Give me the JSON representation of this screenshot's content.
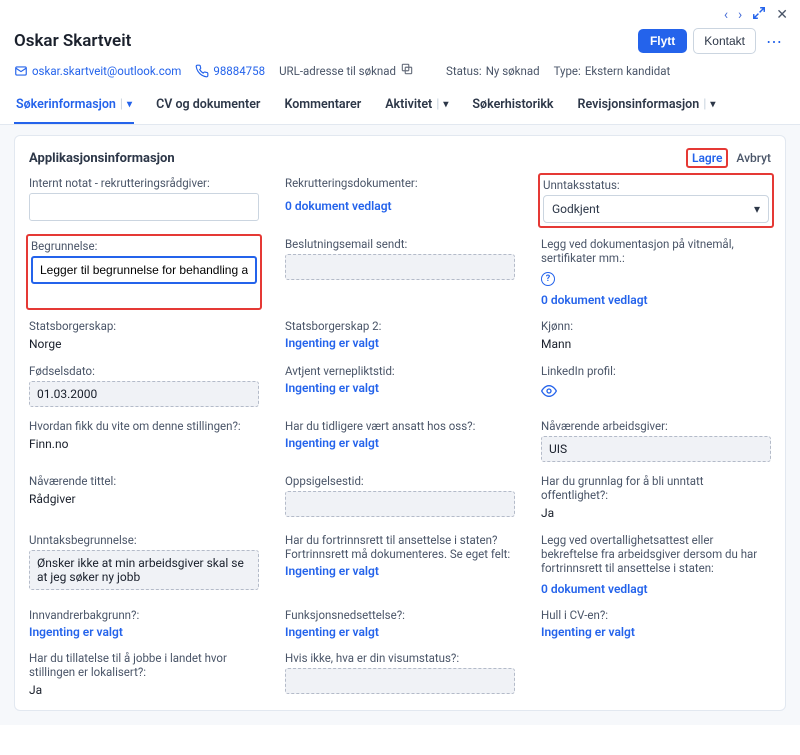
{
  "header": {
    "name": "Oskar Skartveit",
    "email": "oskar.skartveit@outlook.com",
    "phone": "98884758",
    "url_label": "URL-adresse til søknad",
    "status_label": "Status:",
    "status_value": "Ny søknad",
    "type_label": "Type:",
    "type_value": "Ekstern kandidat",
    "move_btn": "Flytt",
    "contact_btn": "Kontakt"
  },
  "tabs": {
    "t0": "Søkerinformasjon",
    "t1": "CV og dokumenter",
    "t2": "Kommentarer",
    "t3": "Aktivitet",
    "t4": "Søkerhistorikk",
    "t5": "Revisjonsinformasjon"
  },
  "panel": {
    "title": "Applikasjonsinformasjon",
    "save": "Lagre",
    "cancel": "Avbryt"
  },
  "fields": {
    "intern_notat_label": "Internt notat - rekrutteringsrådgiver:",
    "rekr_dok_label": "Rekrutteringsdokumenter:",
    "rekr_dok_value": "0 dokument vedlagt",
    "unntak_status_label": "Unntaksstatus:",
    "unntak_status_value": "Godkjent",
    "begrunnelse_label": "Begrunnelse:",
    "begrunnelse_value": "Legger til begrunnelse for behandling av unntak her",
    "beslutning_label": "Beslutningsemail sendt:",
    "vedlegg_label": "Legg ved dokumentasjon på vitnemål, sertifikater mm.:",
    "vedlegg_value": "0 dokument vedlagt",
    "statsborger_label": "Statsborgerskap:",
    "statsborger_value": "Norge",
    "statsborger2_label": "Statsborgerskap 2:",
    "statsborger2_value": "Ingenting er valgt",
    "kjonn_label": "Kjønn:",
    "kjonn_value": "Mann",
    "fodsel_label": "Fødselsdato:",
    "fodsel_value": "01.03.2000",
    "verneplikt_label": "Avtjent vernepliktstid:",
    "verneplikt_value": "Ingenting er valgt",
    "linkedin_label": "LinkedIn profil:",
    "hvordan_label": "Hvordan fikk du vite om denne stillingen?:",
    "hvordan_value": "Finn.no",
    "tidligere_label": "Har du tidligere vært ansatt hos oss?:",
    "tidligere_value": "Ingenting er valgt",
    "navarende_arb_label": "Nåværende arbeidsgiver:",
    "navarende_arb_value": "UIS",
    "navarende_tittel_label": "Nåværende tittel:",
    "navarende_tittel_value": "Rådgiver",
    "oppsigelse_label": "Oppsigelsestid:",
    "grunnlag_label": "Har du grunnlag for å bli unntatt offentlighet?:",
    "grunnlag_value": "Ja",
    "unntak_begr_label": "Unntaksbegrunnelse:",
    "unntak_begr_value": "Ønsker ikke at min arbeidsgiver skal se at jeg søker ny jobb",
    "fortrinn_label": "Har du fortrinnsrett til ansettelse i staten? Fortrinnsrett må dokumenteres. Se eget felt:",
    "fortrinn_value": "Ingenting er valgt",
    "overtall_label": "Legg ved overtallighetsattest eller bekreftelse fra arbeidsgiver dersom du har fortrinnsrett til ansettelse i staten:",
    "overtall_value": "0 dokument vedlagt",
    "innvandrer_label": "Innvandrerbakgrunn?:",
    "innvandrer_value": "Ingenting er valgt",
    "funksjon_label": "Funksjonsnedsettelse?:",
    "funksjon_value": "Ingenting er valgt",
    "hull_label": "Hull i CV-en?:",
    "hull_value": "Ingenting er valgt",
    "jobb_landet_label": "Har du tillatelse til å jobbe i landet hvor stillingen er lokalisert?:",
    "jobb_landet_value": "Ja",
    "visum_label": "Hvis ikke, hva er din visumstatus?:"
  }
}
